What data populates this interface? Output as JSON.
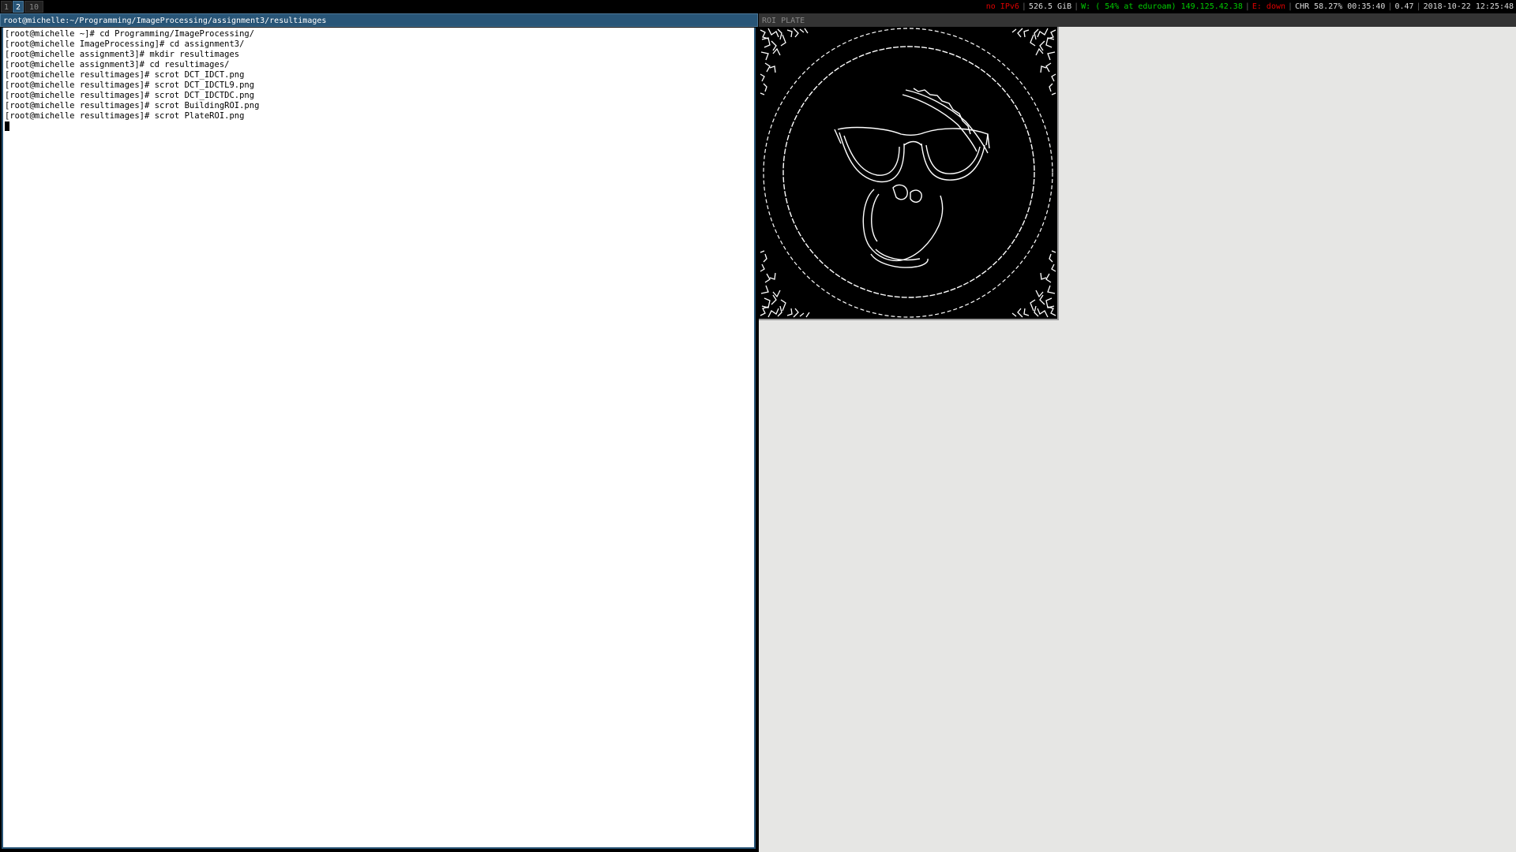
{
  "workspaces": [
    {
      "label": "1",
      "focused": false
    },
    {
      "label": "2",
      "focused": true
    },
    {
      "label": "10",
      "focused": false
    }
  ],
  "status": {
    "ipv6": "no IPv6",
    "disk": "526.5 GiB",
    "wireless": "W: ( 54% at eduroam) 149.125.42.38",
    "ethernet": "E: down",
    "battery": "CHR 58.27% 00:35:40",
    "load": "0.47",
    "datetime": "2018-10-22 12:25:48",
    "colors": {
      "bad": "#dd0000",
      "good": "#00cc00",
      "normal": "#dddddd"
    }
  },
  "terminal": {
    "title": "root@michelle:~/Programming/ImageProcessing/assignment3/resultimages",
    "lines": [
      "[root@michelle ~]# cd Programming/ImageProcessing/",
      "[root@michelle ImageProcessing]# cd assignment3/",
      "[root@michelle assignment3]# mkdir resultimages",
      "[root@michelle assignment3]# cd resultimages/",
      "[root@michelle resultimages]# scrot DCT_IDCT.png",
      "[root@michelle resultimages]# scrot DCT_IDCTL9.png",
      "[root@michelle resultimages]# scrot DCT_IDCTDC.png",
      "[root@michelle resultimages]# scrot BuildingROI.png",
      "[root@michelle resultimages]# scrot PlateROI.png"
    ]
  },
  "viewer": {
    "title": "ROI PLATE",
    "image_icon": "edge-detected-plate-image"
  }
}
